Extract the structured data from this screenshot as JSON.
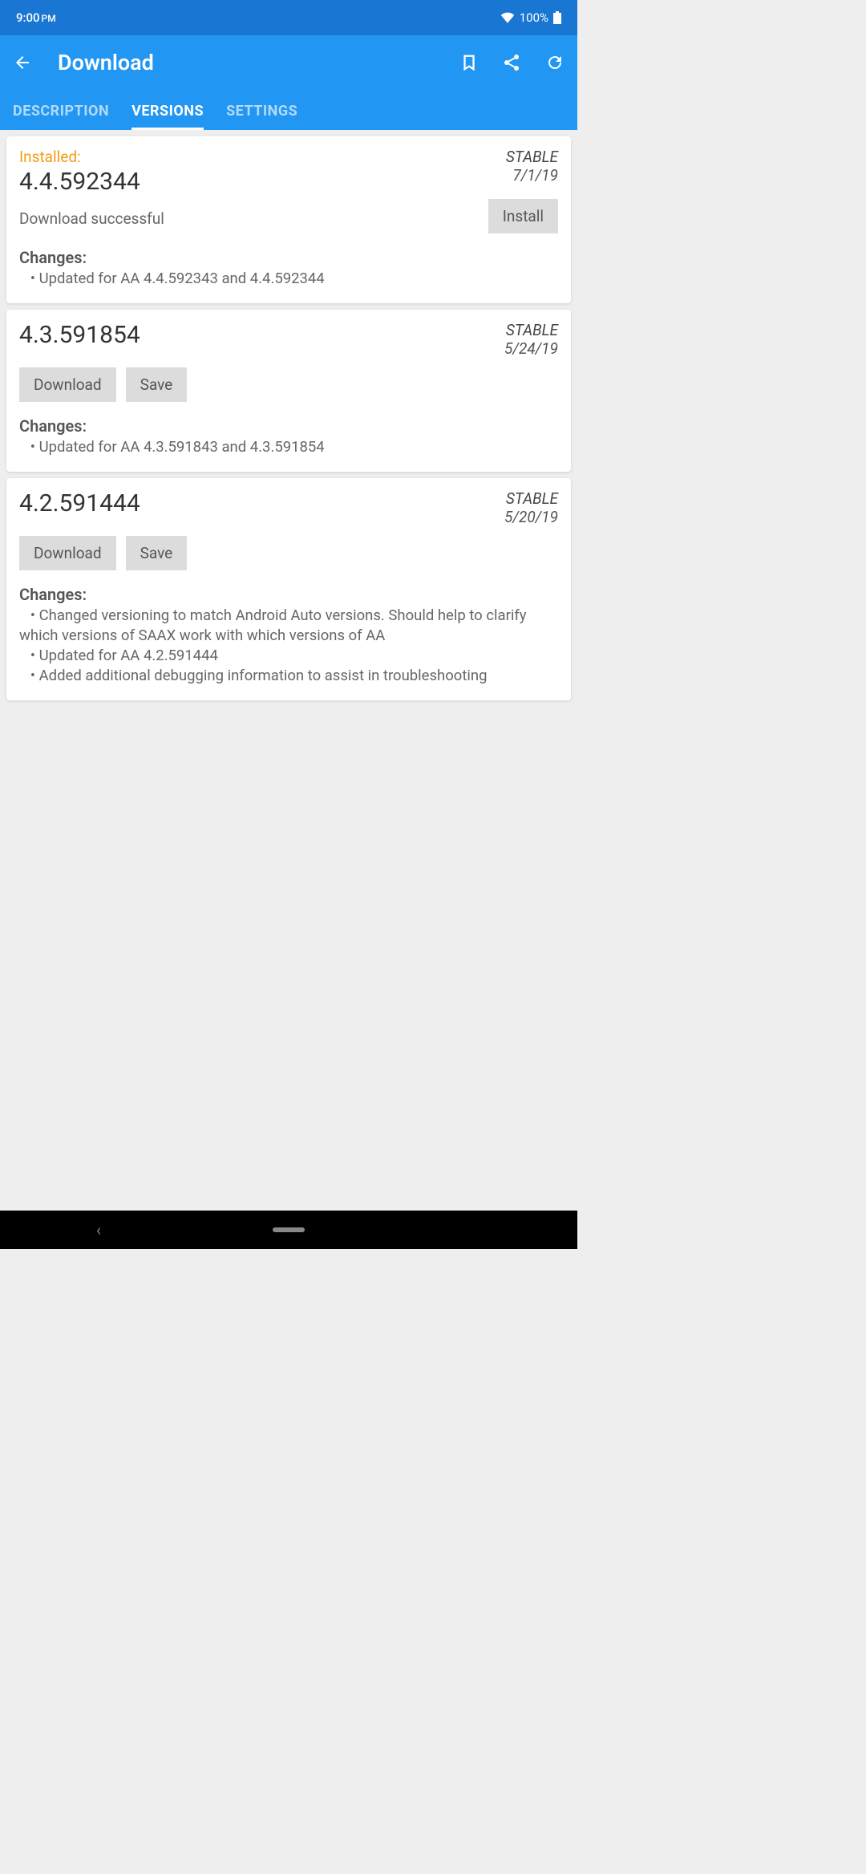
{
  "statusBar": {
    "time": "9:00",
    "ampm": "PM",
    "battery": "100%"
  },
  "appBar": {
    "title": "Download",
    "tabs": {
      "description": "DESCRIPTION",
      "versions": "VERSIONS",
      "settings": "SETTINGS"
    }
  },
  "labels": {
    "installed": "Installed:",
    "changes": "Changes:",
    "download": "Download",
    "save": "Save",
    "install": "Install"
  },
  "versions": [
    {
      "installed": true,
      "version": "4.4.592344",
      "stability": "STABLE",
      "date": "7/1/19",
      "subtitle": "Download successful",
      "installBtn": true,
      "changes": "   • Updated for AA 4.4.592343 and 4.4.592344"
    },
    {
      "installed": false,
      "version": "4.3.591854",
      "stability": "STABLE",
      "date": "5/24/19",
      "downloadSave": true,
      "changes": "   • Updated for AA 4.3.591843 and 4.3.591854"
    },
    {
      "installed": false,
      "version": "4.2.591444",
      "stability": "STABLE",
      "date": "5/20/19",
      "downloadSave": true,
      "changes": "   • Changed versioning to match Android Auto versions. Should help to clarify which versions of SAAX work with which versions of AA\n   • Updated for AA 4.2.591444\n   • Added additional debugging information to assist in troubleshooting"
    }
  ]
}
